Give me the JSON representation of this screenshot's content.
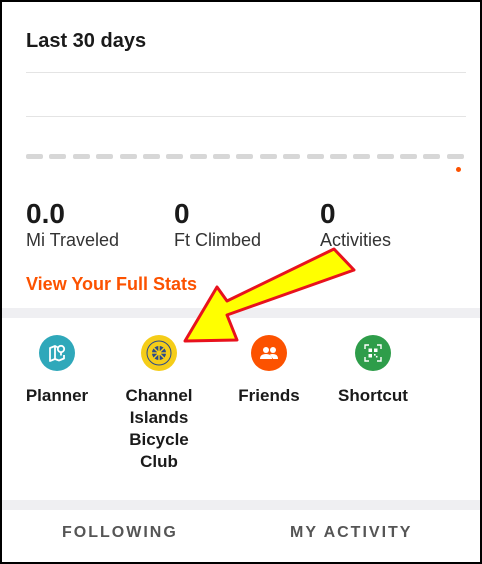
{
  "header": {
    "title": "Last 30 days"
  },
  "stats": [
    {
      "value": "0.0",
      "label": "Mi Traveled"
    },
    {
      "value": "0",
      "label": "Ft Climbed"
    },
    {
      "value": "0",
      "label": "Activities"
    }
  ],
  "full_stats_link": "View Your Full Stats",
  "shortcuts": [
    {
      "label": "Planner",
      "icon": "map-pin-icon",
      "color": "#2fa8ba"
    },
    {
      "label": "Channel Islands Bicycle Club",
      "lines": [
        "Channel",
        "Islands",
        "Bicycle",
        "Club"
      ],
      "icon": "club-logo-icon",
      "color": "#f5cd18"
    },
    {
      "label": "Friends",
      "icon": "friends-icon",
      "color": "#fc5200"
    },
    {
      "label": "Shortcut",
      "icon": "qr-code-icon",
      "color": "#2e9d4a"
    }
  ],
  "tabs": [
    {
      "label": "FOLLOWING"
    },
    {
      "label": "MY ACTIVITY"
    }
  ],
  "colors": {
    "accent": "#fc5200",
    "annotation_arrow_fill": "#ffff00",
    "annotation_arrow_stroke": "#e8121d"
  }
}
